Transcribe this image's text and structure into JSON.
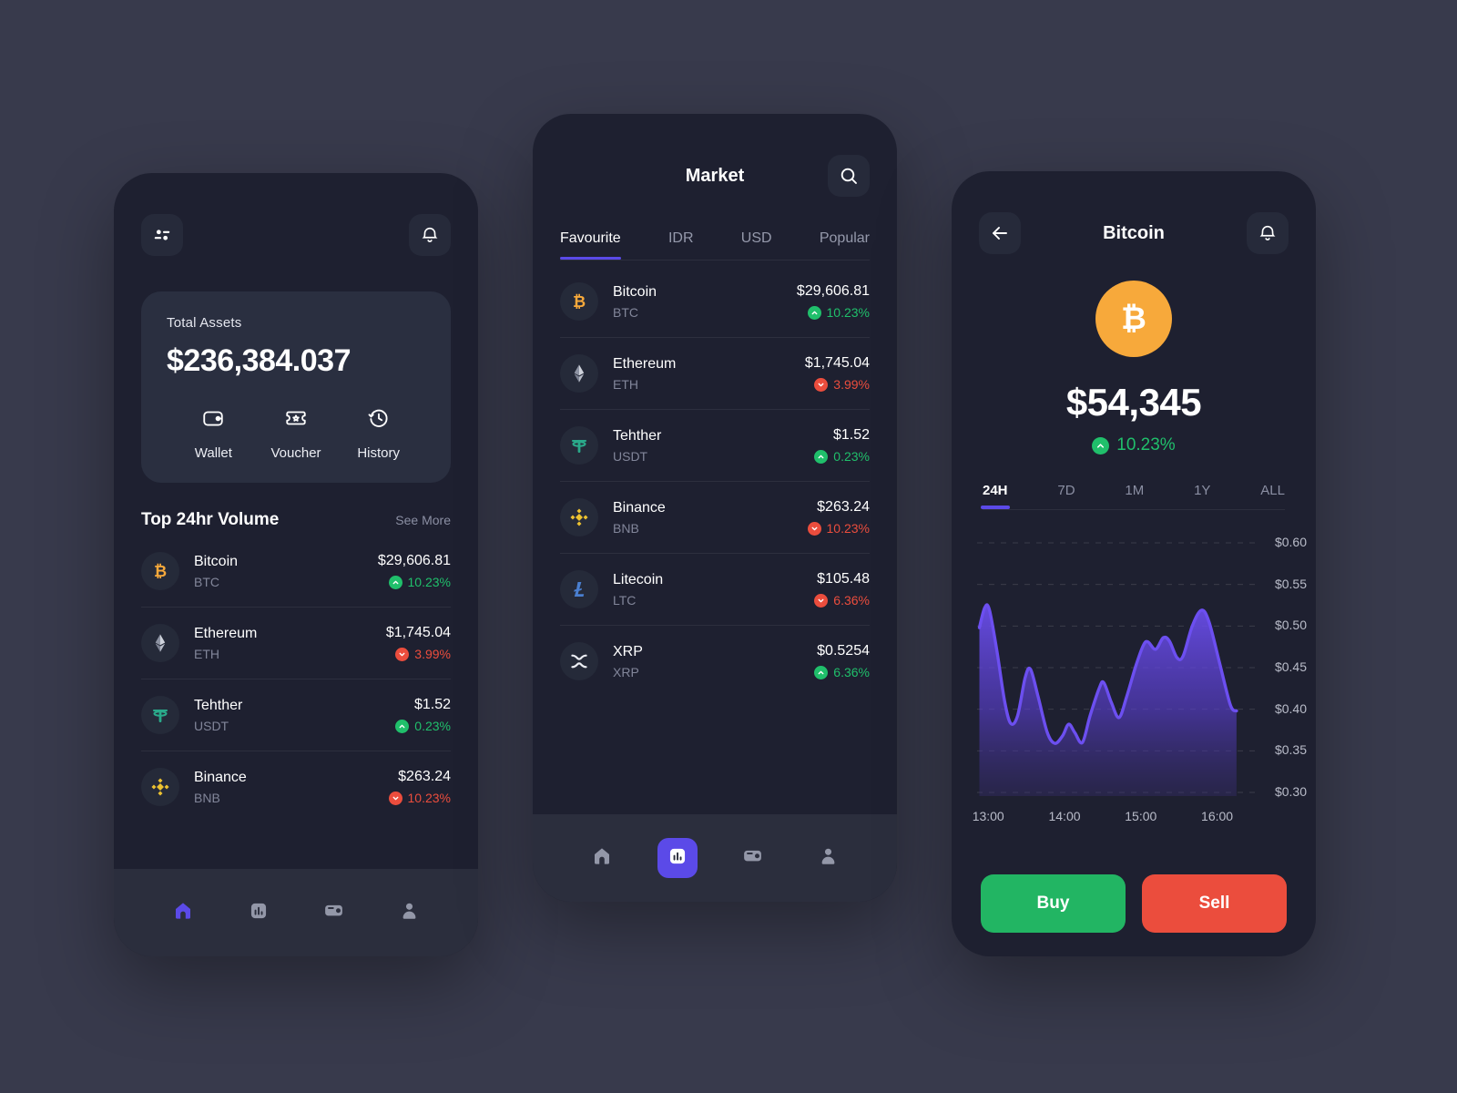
{
  "theme": {
    "accent": "#5b4ae8",
    "page_bg": "#383a4c",
    "phone_bg": "#1e2030",
    "card_bg": "#2a2f40",
    "up_color": "#20bf6b",
    "down_color": "#eb4d3d",
    "bitcoin_orange": "#f7a93b",
    "buy_green": "#22b563",
    "sell_red": "#eb4d3d"
  },
  "home": {
    "menu_icon": "sliders-icon",
    "bell_icon": "bell-icon",
    "assets": {
      "label": "Total Assets",
      "value": "$236,384.037",
      "actions": [
        {
          "label": "Wallet",
          "icon": "wallet-icon"
        },
        {
          "label": "Voucher",
          "icon": "ticket-icon"
        },
        {
          "label": "History",
          "icon": "clock-history-icon"
        }
      ]
    },
    "section": {
      "title": "Top 24hr Volume",
      "more_label": "See More"
    },
    "coins": [
      {
        "name": "Bitcoin",
        "ticker": "BTC",
        "price": "$29,606.81",
        "change": "10.23%",
        "dir": "up",
        "icon": "bitcoin-icon"
      },
      {
        "name": "Ethereum",
        "ticker": "ETH",
        "price": "$1,745.04",
        "change": "3.99%",
        "dir": "down",
        "icon": "ethereum-icon"
      },
      {
        "name": "Tehther",
        "ticker": "USDT",
        "price": "$1.52",
        "change": "0.23%",
        "dir": "up",
        "icon": "tether-icon"
      },
      {
        "name": "Binance",
        "ticker": "BNB",
        "price": "$263.24",
        "change": "10.23%",
        "dir": "down",
        "icon": "binance-icon"
      }
    ],
    "nav": [
      {
        "name": "home",
        "icon": "home-icon",
        "state": "active-plain"
      },
      {
        "name": "market",
        "icon": "bars-icon",
        "state": "idle"
      },
      {
        "name": "wallet",
        "icon": "wallet-icon",
        "state": "idle"
      },
      {
        "name": "profile",
        "icon": "person-icon",
        "state": "idle"
      }
    ]
  },
  "market": {
    "title": "Market",
    "search_icon": "search-icon",
    "tabs": [
      {
        "label": "Favourite",
        "active": true
      },
      {
        "label": "IDR",
        "active": false
      },
      {
        "label": "USD",
        "active": false
      },
      {
        "label": "Popular",
        "active": false
      }
    ],
    "coins": [
      {
        "name": "Bitcoin",
        "ticker": "BTC",
        "price": "$29,606.81",
        "change": "10.23%",
        "dir": "up",
        "icon": "bitcoin-icon"
      },
      {
        "name": "Ethereum",
        "ticker": "ETH",
        "price": "$1,745.04",
        "change": "3.99%",
        "dir": "down",
        "icon": "ethereum-icon"
      },
      {
        "name": "Tehther",
        "ticker": "USDT",
        "price": "$1.52",
        "change": "0.23%",
        "dir": "up",
        "icon": "tether-icon"
      },
      {
        "name": "Binance",
        "ticker": "BNB",
        "price": "$263.24",
        "change": "10.23%",
        "dir": "down",
        "icon": "binance-icon"
      },
      {
        "name": "Litecoin",
        "ticker": "LTC",
        "price": "$105.48",
        "change": "6.36%",
        "dir": "down",
        "icon": "litecoin-icon"
      },
      {
        "name": "XRP",
        "ticker": "XRP",
        "price": "$0.5254",
        "change": "6.36%",
        "dir": "up",
        "icon": "xrp-icon"
      }
    ],
    "nav": [
      {
        "name": "home",
        "icon": "home-icon",
        "state": "idle"
      },
      {
        "name": "market",
        "icon": "bars-icon",
        "state": "active-box"
      },
      {
        "name": "wallet",
        "icon": "wallet-icon",
        "state": "idle"
      },
      {
        "name": "profile",
        "icon": "person-icon",
        "state": "idle"
      }
    ]
  },
  "detail": {
    "back_icon": "arrow-left-icon",
    "title": "Bitcoin",
    "bell_icon": "bell-icon",
    "logo_icon": "bitcoin-icon",
    "price": "$54,345",
    "change": "10.23%",
    "change_dir": "up",
    "ranges": [
      {
        "label": "24H",
        "active": true
      },
      {
        "label": "7D",
        "active": false
      },
      {
        "label": "1M",
        "active": false
      },
      {
        "label": "1Y",
        "active": false
      },
      {
        "label": "ALL",
        "active": false
      }
    ],
    "buy_label": "Buy",
    "sell_label": "Sell"
  },
  "chart_data": {
    "type": "area",
    "title": "Bitcoin 24H price",
    "xlabel": "",
    "ylabel": "",
    "grid": true,
    "legend": "none",
    "line_color": "#6c4ff0",
    "fill_gradient": [
      "#6c4ff0",
      "#2a2550"
    ],
    "ylim": [
      0.28,
      0.615
    ],
    "y_ticks": [
      "$0.60",
      "$0.55",
      "$0.50",
      "$0.45",
      "$0.40",
      "$0.35",
      "$0.30"
    ],
    "y_tick_values": [
      0.6,
      0.55,
      0.5,
      0.45,
      0.4,
      0.35,
      0.3
    ],
    "x_ticks": [
      "13:00",
      "14:00",
      "15:00",
      "16:00"
    ],
    "x_tick_values": [
      13.0,
      14.0,
      15.0,
      16.0
    ],
    "xlim": [
      12.92,
      16.62
    ],
    "points": [
      {
        "t": 12.95,
        "v": 0.498
      },
      {
        "t": 13.02,
        "v": 0.522
      },
      {
        "t": 13.08,
        "v": 0.52
      },
      {
        "t": 13.18,
        "v": 0.47
      },
      {
        "t": 13.28,
        "v": 0.41
      },
      {
        "t": 13.36,
        "v": 0.383
      },
      {
        "t": 13.45,
        "v": 0.392
      },
      {
        "t": 13.55,
        "v": 0.438
      },
      {
        "t": 13.62,
        "v": 0.448
      },
      {
        "t": 13.72,
        "v": 0.415
      },
      {
        "t": 13.84,
        "v": 0.372
      },
      {
        "t": 13.94,
        "v": 0.359
      },
      {
        "t": 14.04,
        "v": 0.368
      },
      {
        "t": 14.12,
        "v": 0.382
      },
      {
        "t": 14.2,
        "v": 0.372
      },
      {
        "t": 14.3,
        "v": 0.36
      },
      {
        "t": 14.4,
        "v": 0.392
      },
      {
        "t": 14.52,
        "v": 0.425
      },
      {
        "t": 14.58,
        "v": 0.432
      },
      {
        "t": 14.68,
        "v": 0.408
      },
      {
        "t": 14.78,
        "v": 0.39
      },
      {
        "t": 14.88,
        "v": 0.415
      },
      {
        "t": 15.0,
        "v": 0.452
      },
      {
        "t": 15.1,
        "v": 0.477
      },
      {
        "t": 15.16,
        "v": 0.481
      },
      {
        "t": 15.26,
        "v": 0.472
      },
      {
        "t": 15.36,
        "v": 0.486
      },
      {
        "t": 15.44,
        "v": 0.482
      },
      {
        "t": 15.54,
        "v": 0.462
      },
      {
        "t": 15.62,
        "v": 0.464
      },
      {
        "t": 15.74,
        "v": 0.5
      },
      {
        "t": 15.86,
        "v": 0.519
      },
      {
        "t": 15.96,
        "v": 0.505
      },
      {
        "t": 16.1,
        "v": 0.455
      },
      {
        "t": 16.24,
        "v": 0.405
      },
      {
        "t": 16.32,
        "v": 0.398
      }
    ],
    "x_label_positions": [
      "13:00",
      "14:00",
      "15:00",
      "16:00"
    ]
  }
}
